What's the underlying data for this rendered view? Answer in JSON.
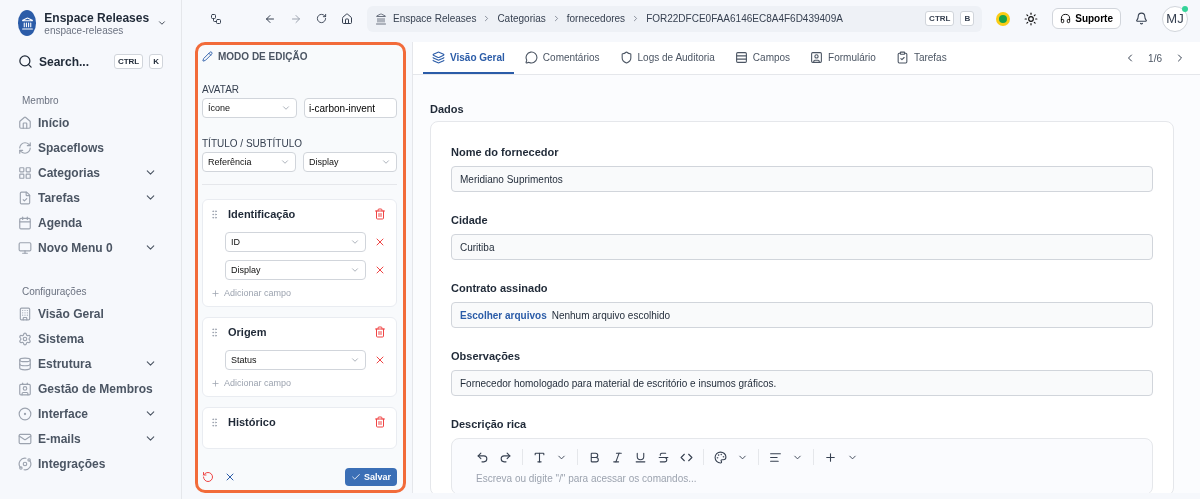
{
  "workspace": {
    "name": "Enspace Releases",
    "slug": "enspace-releases"
  },
  "search": {
    "label": "Search...",
    "keys": [
      "CTRL",
      "K"
    ]
  },
  "sidebar": {
    "sections": [
      {
        "title": "Membro",
        "items": [
          {
            "label": "Início",
            "expandable": false
          },
          {
            "label": "Spaceflows",
            "expandable": false
          },
          {
            "label": "Categorias",
            "expandable": true
          },
          {
            "label": "Tarefas",
            "expandable": true
          },
          {
            "label": "Agenda",
            "expandable": false
          },
          {
            "label": "Novo Menu 0",
            "expandable": true
          }
        ]
      },
      {
        "title": "Configurações",
        "items": [
          {
            "label": "Visão Geral",
            "expandable": false
          },
          {
            "label": "Sistema",
            "expandable": false
          },
          {
            "label": "Estrutura",
            "expandable": true
          },
          {
            "label": "Gestão de Membros",
            "expandable": false
          },
          {
            "label": "Interface",
            "expandable": true
          },
          {
            "label": "E-mails",
            "expandable": true
          },
          {
            "label": "Integrações",
            "expandable": false
          }
        ]
      }
    ]
  },
  "breadcrumb": [
    "Enspace Releases",
    "Categorias",
    "fornecedores",
    "FOR22DFCE0FAA6146EC8A4F6D439409A"
  ],
  "shortcut_keys": [
    "CTRL",
    "B"
  ],
  "support_button": "Suporte",
  "avatar": "MJ",
  "edit_panel": {
    "title": "MODO DE EDIÇÃO",
    "avatar_label": "AVATAR",
    "avatar_type": "Ícone",
    "avatar_value": "i-carbon-invent",
    "title_label": "TÍTULO / SUBTÍTULO",
    "title_field": "Referência",
    "subtitle_field": "Display",
    "groups": [
      {
        "name": "Identificação",
        "fields": [
          "ID",
          "Display"
        ],
        "add_label": "Adicionar campo"
      },
      {
        "name": "Origem",
        "fields": [
          "Status"
        ],
        "add_label": "Adicionar campo"
      },
      {
        "name": "Histórico"
      }
    ],
    "save": "Salvar"
  },
  "tabs": [
    {
      "label": "Visão Geral",
      "selected": true
    },
    {
      "label": "Comentários",
      "selected": false
    },
    {
      "label": "Logs de Auditoria",
      "selected": false
    },
    {
      "label": "Campos",
      "selected": false
    },
    {
      "label": "Formulário",
      "selected": false
    },
    {
      "label": "Tarefas",
      "selected": false
    }
  ],
  "pager": "1/6",
  "section_title": "Dados",
  "fields": [
    {
      "kind": "text",
      "label": "Nome do fornecedor",
      "value": "Meridiano Suprimentos"
    },
    {
      "kind": "text",
      "label": "Cidade",
      "value": "Curitiba"
    },
    {
      "kind": "file",
      "label": "Contrato assinado",
      "button": "Escolher arquivos",
      "value": "Nenhum arquivo escolhido"
    },
    {
      "kind": "text",
      "label": "Observações",
      "value": "Fornecedor homologado para material de escritório e insumos gráficos."
    },
    {
      "kind": "rich",
      "label": "Descrição rica",
      "placeholder": "Escreva ou digite \"/\" para acessar os comandos..."
    }
  ]
}
